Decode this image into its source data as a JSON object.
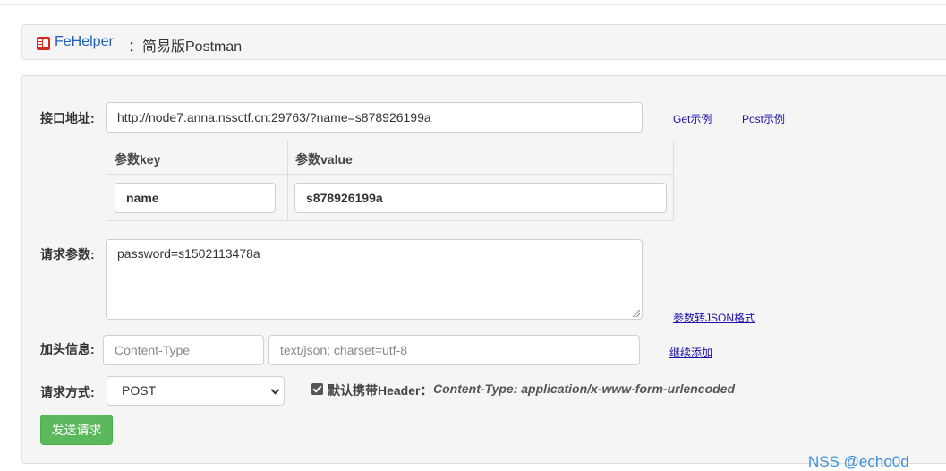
{
  "header": {
    "brand": "FeHelper",
    "title": "：简易版Postman"
  },
  "form": {
    "url_label": "接口地址:",
    "url_value": "http://node7.anna.nssctf.cn:29763/?name=s878926199a",
    "get_example": "Get示例",
    "post_example": "Post示例",
    "params_table": {
      "col_key": "参数key",
      "col_value": "参数value",
      "rows": [
        {
          "key": "name",
          "value": "s878926199a"
        }
      ]
    },
    "body_label": "请求参数:",
    "body_value": "password=s1502113478a",
    "to_json_link": "参数转JSON格式",
    "header_label": "加头信息:",
    "header_key_placeholder": "Content-Type",
    "header_value_placeholder": "text/json; charset=utf-8",
    "add_more_link": "继续添加",
    "method_label": "请求方式:",
    "method_value": "POST",
    "default_header_label": "默认携带Header：",
    "default_header_value": "Content-Type: application/x-www-form-urlencoded",
    "default_header_checked": true,
    "send_button": "发送请求"
  },
  "watermark": "NSS @echo0d",
  "colors": {
    "brand": "#1f5fbf",
    "send_button": "#5cb85c",
    "link": "#1a0dab",
    "watermark": "#3a8fd9"
  }
}
